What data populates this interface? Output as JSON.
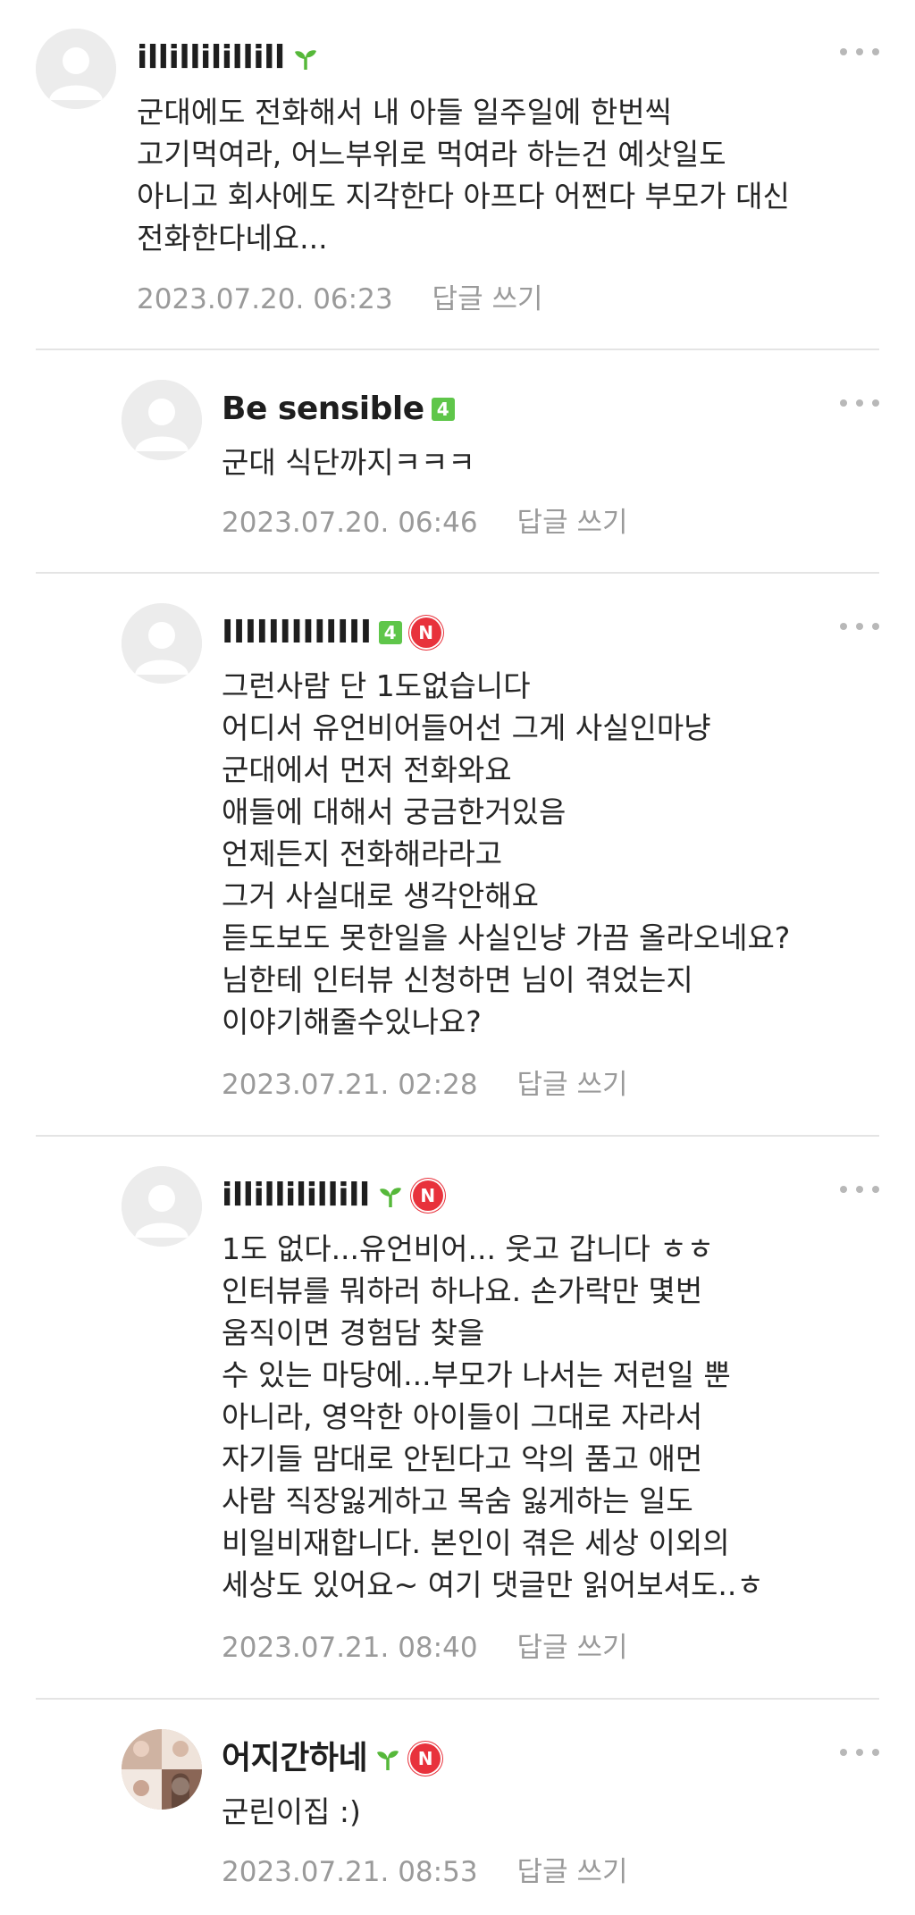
{
  "comments": [
    {
      "nickname": "illillilillill",
      "level_badge": "",
      "has_new_badge": false,
      "has_sprout": true,
      "text": "군대에도 전화해서 내 아들 일주일에 한번씩\n고기먹여라, 어느부위로 먹여라 하는건 예삿일도\n아니고 회사에도 지각한다 아프다 어쩐다 부모가 대신\n전화한다네요...",
      "date": "2023.07.20. 06:23",
      "reply_label": "답글 쓰기"
    },
    {
      "nickname": "Be sensible",
      "level_badge": "4",
      "has_new_badge": false,
      "has_sprout": false,
      "text": "군대 식단까지ㅋㅋㅋ",
      "date": "2023.07.20. 06:46",
      "reply_label": "답글 쓰기"
    },
    {
      "nickname": "IIIIIIIIIIIII",
      "level_badge": "4",
      "has_new_badge": true,
      "has_sprout": false,
      "text": "그런사람 단 1도없습니다\n어디서 유언비어들어선 그게 사실인마냥\n군대에서 먼저 전화와요\n애들에 대해서 궁금한거있음\n언제든지 전화해라라고\n그거 사실대로 생각안해요\n듣도보도 못한일을 사실인냥 가끔 올라오네요?\n님한테 인터뷰 신청하면 님이 겪었는지\n이야기해줄수있나요?",
      "date": "2023.07.21. 02:28",
      "reply_label": "답글 쓰기"
    },
    {
      "nickname": "illillilillill",
      "level_badge": "",
      "has_new_badge": true,
      "has_sprout": true,
      "text": "1도 없다...유언비어... 웃고 갑니다 ㅎㅎ\n인터뷰를 뭐하러 하나요. 손가락만 몇번\n움직이면 경험담 찾을\n수 있는 마당에...부모가 나서는 저런일 뿐\n아니라, 영악한 아이들이 그대로 자라서\n자기들 맘대로 안된다고 악의 품고 애먼\n사람 직장잃게하고 목숨 잃게하는 일도\n비일비재합니다. 본인이 겪은 세상 이외의\n세상도 있어요~ 여기 댓글만 읽어보셔도..ㅎ",
      "date": "2023.07.21. 08:40",
      "reply_label": "답글 쓰기"
    },
    {
      "nickname": "어지간하네",
      "level_badge": "",
      "has_new_badge": true,
      "has_sprout": true,
      "text": "군린이집 :)",
      "date": "2023.07.21. 08:53",
      "reply_label": "답글 쓰기"
    }
  ],
  "badges": {
    "new_badge_text": "N"
  },
  "colors": {
    "sprout_green": "#56b83a",
    "level_green": "#5fc64a",
    "new_red": "#e8323c",
    "meta_gray": "#9a9a9a"
  }
}
